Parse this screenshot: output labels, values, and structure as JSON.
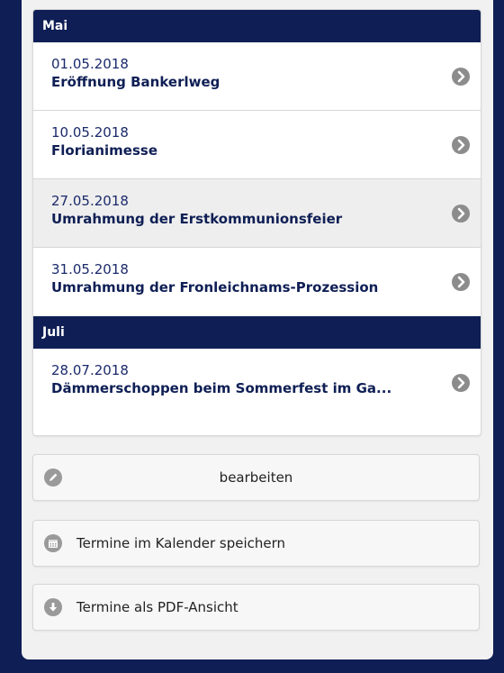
{
  "groups": [
    {
      "month": "Mai",
      "events": [
        {
          "date": "01.05.2018",
          "title": "Eröffnung Bankerlweg"
        },
        {
          "date": "10.05.2018",
          "title": "Florianimesse"
        },
        {
          "date": "27.05.2018",
          "title": "Umrahmung der Erstkommunionsfeier"
        },
        {
          "date": "31.05.2018",
          "title": "Umrahmung der Fronleichnams-Prozession"
        }
      ]
    },
    {
      "month": "Juli",
      "events": [
        {
          "date": "28.07.2018",
          "title": "Dämmerschoppen beim Sommerfest im Ga..."
        }
      ]
    }
  ],
  "actions": {
    "edit_label": "bearbeiten",
    "calendar_label": "Termine im Kalender speichern",
    "pdf_label": "Termine als PDF-Ansicht"
  },
  "icons": {
    "chevron": "chevron-right-circle-icon",
    "edit": "pencil-icon",
    "calendar": "calendar-icon",
    "pdf": "download-icon"
  },
  "colors": {
    "navy": "#0f1f55",
    "highlight_row": "#eeeeee",
    "icon_gray": "#8c8c8c"
  }
}
